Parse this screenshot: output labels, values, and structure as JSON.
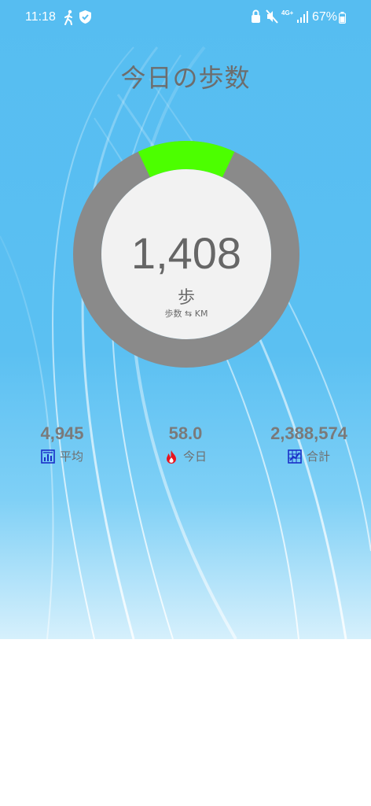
{
  "status_bar": {
    "time": "11:18",
    "network": "4G+",
    "battery_percent": "67%",
    "icons": [
      "walking-icon",
      "shield-check-icon",
      "lock-icon",
      "mute-icon",
      "signal-icon",
      "battery-icon"
    ]
  },
  "title": "今日の歩数",
  "steps": {
    "count": "1,408",
    "unit": "歩",
    "toggle_label": "歩数 ⇆ KM",
    "progress_fraction": 0.14
  },
  "stats": [
    {
      "value": "4,945",
      "label": "平均",
      "icon": "bar-chart-icon"
    },
    {
      "value": "58.0",
      "label": "今日",
      "icon": "flame-icon"
    },
    {
      "value": "2,388,574",
      "label": "合計",
      "icon": "grid-chart-icon"
    }
  ],
  "colors": {
    "background": "#56bdf1",
    "ring_track": "#8a8a8a",
    "ring_progress": "#4cff00",
    "inner_circle": "#f2f2f2",
    "text_gray": "#6d6d6d",
    "stat_icon_blue": "#1a2fc8",
    "flame_red": "#e8141e"
  }
}
